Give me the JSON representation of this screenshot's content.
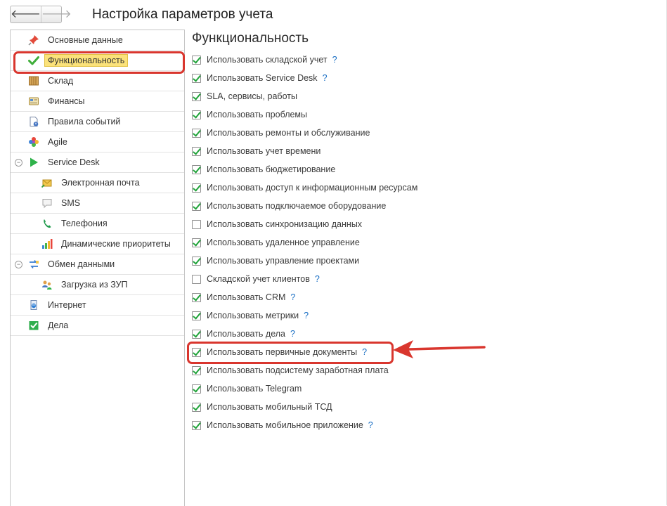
{
  "window": {
    "title": "Настройка параметров учета",
    "back_label": "🡐",
    "forward_label": "🡒"
  },
  "sidebar": {
    "items": [
      {
        "label": "Основные данные",
        "icon": "pin-icon",
        "level": 0
      },
      {
        "label": "Функциональность",
        "icon": "checkmark-icon",
        "level": 0,
        "selected": true
      },
      {
        "label": "Склад",
        "icon": "warehouse-icon",
        "level": 0
      },
      {
        "label": "Финансы",
        "icon": "finance-icon",
        "level": 0
      },
      {
        "label": "Правила событий",
        "icon": "event-rules-icon",
        "level": 0
      },
      {
        "label": "Agile",
        "icon": "agile-flower-icon",
        "level": 0
      },
      {
        "label": "Service Desk",
        "icon": "play-triangle-icon",
        "level": 0,
        "collapsible": true
      },
      {
        "label": "Электронная почта",
        "icon": "email-icon",
        "level": 1
      },
      {
        "label": "SMS",
        "icon": "sms-bubble-icon",
        "level": 1
      },
      {
        "label": "Телефония",
        "icon": "phone-icon",
        "level": 1
      },
      {
        "label": "Динамические приоритеты",
        "icon": "bar-chart-icon",
        "level": 1
      },
      {
        "label": "Обмен данными",
        "icon": "data-exchange-icon",
        "level": 0,
        "collapsible": true
      },
      {
        "label": "Загрузка из ЗУП",
        "icon": "users-import-icon",
        "level": 1
      },
      {
        "label": "Интернет",
        "icon": "internet-icon",
        "level": 0
      },
      {
        "label": "Дела",
        "icon": "tasks-check-icon",
        "level": 0
      }
    ]
  },
  "main": {
    "section_title": "Функциональность",
    "help_label": "?",
    "options": [
      {
        "label": "Использовать складской учет",
        "checked": true,
        "help": true
      },
      {
        "label": "Использовать Service Desk",
        "checked": true,
        "help": true
      },
      {
        "label": "SLA, сервисы, работы",
        "checked": true,
        "help": false
      },
      {
        "label": "Использовать проблемы",
        "checked": true,
        "help": false
      },
      {
        "label": "Использовать ремонты и обслуживание",
        "checked": true,
        "help": false
      },
      {
        "label": "Использовать учет времени",
        "checked": true,
        "help": false
      },
      {
        "label": "Использовать бюджетирование",
        "checked": true,
        "help": false
      },
      {
        "label": "Использовать доступ к информационным ресурсам",
        "checked": true,
        "help": false
      },
      {
        "label": "Использовать подключаемое оборудование",
        "checked": true,
        "help": false
      },
      {
        "label": "Использовать синхронизацию данных",
        "checked": false,
        "help": false
      },
      {
        "label": "Использовать удаленное управление",
        "checked": true,
        "help": false
      },
      {
        "label": "Использовать управление проектами",
        "checked": true,
        "help": false
      },
      {
        "label": "Складской учет клиентов",
        "checked": false,
        "help": true
      },
      {
        "label": "Использовать CRM",
        "checked": true,
        "help": true
      },
      {
        "label": "Использовать метрики",
        "checked": true,
        "help": true
      },
      {
        "label": "Использовать дела",
        "checked": true,
        "help": true
      },
      {
        "label": "Использовать первичные документы",
        "checked": true,
        "help": true,
        "highlighted": true
      },
      {
        "label": "Использовать подсистему заработная плата",
        "checked": true,
        "help": false
      },
      {
        "label": "Использовать Telegram",
        "checked": true,
        "help": false
      },
      {
        "label": "Использовать мобильный ТСД",
        "checked": true,
        "help": false
      },
      {
        "label": "Использовать мобильное приложение",
        "checked": true,
        "help": true
      }
    ]
  },
  "colors": {
    "highlight_border": "#d9362e",
    "selected_bg": "#fbe27a",
    "check_green": "#21a33a",
    "help_blue": "#1a6fc4"
  }
}
